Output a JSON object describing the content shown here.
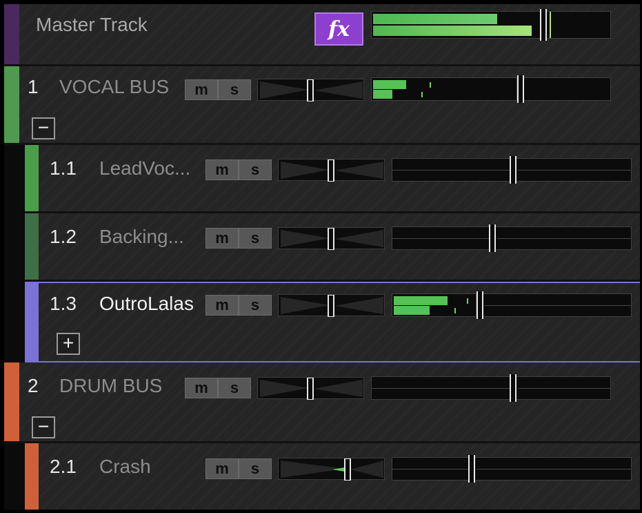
{
  "colors": {
    "master": "#4a2a5e",
    "vocal_bus": "#4f9a4f",
    "lead": "#4a9e4a",
    "backing": "#3e6f46",
    "outro": "#7a72d6",
    "drum_bus": "#d0603a",
    "crash": "#d0603a",
    "meter_green": "#55c255"
  },
  "master": {
    "name": "Master Track",
    "fx_label": "fx",
    "meter_level_l": 0.55,
    "meter_level_r": 0.68
  },
  "tracks": [
    {
      "number": "1",
      "name": "VOCAL BUS",
      "mute": "m",
      "solo": "s",
      "fold": "−"
    },
    {
      "number": "1.1",
      "name": "LeadVoc...",
      "mute": "m",
      "solo": "s"
    },
    {
      "number": "1.2",
      "name": "Backing...",
      "mute": "m",
      "solo": "s"
    },
    {
      "number": "1.3",
      "name": "OutroLalas",
      "mute": "m",
      "solo": "s",
      "fold": "+"
    },
    {
      "number": "2",
      "name": "DRUM BUS",
      "mute": "m",
      "solo": "s",
      "fold": "−"
    },
    {
      "number": "2.1",
      "name": "Crash",
      "mute": "m",
      "solo": "s"
    }
  ]
}
